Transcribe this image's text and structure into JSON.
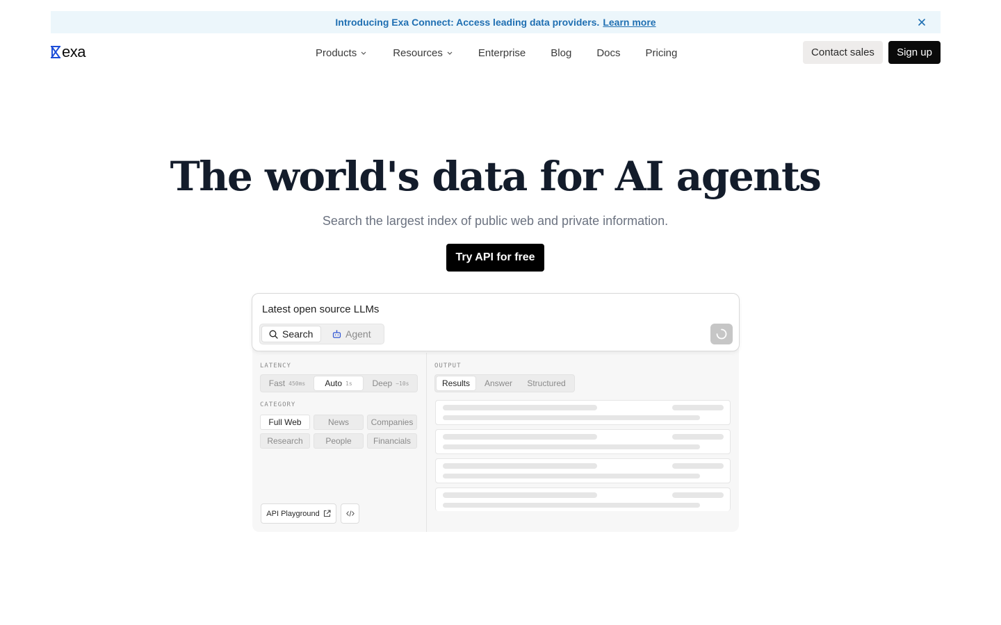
{
  "banner": {
    "message": "Introducing Exa Connect: Access leading data providers.",
    "link": "Learn more"
  },
  "brand": {
    "name": "exa",
    "accent": "#1d4ed8"
  },
  "nav": {
    "items": [
      {
        "label": "Products",
        "dropdown": true
      },
      {
        "label": "Resources",
        "dropdown": true
      },
      {
        "label": "Enterprise",
        "dropdown": false
      },
      {
        "label": "Blog",
        "dropdown": false
      },
      {
        "label": "Docs",
        "dropdown": false
      },
      {
        "label": "Pricing",
        "dropdown": false
      }
    ],
    "contact_sales": "Contact sales",
    "sign_up": "Sign up"
  },
  "hero": {
    "title": "The world's data for AI agents",
    "subtitle": "Search the largest index of public web and private information.",
    "cta": "Try API for free"
  },
  "demo": {
    "query": "Latest open source LLMs",
    "modes": [
      "Search",
      "Agent"
    ],
    "active_mode": "Search",
    "latency": {
      "label": "LATENCY",
      "options": [
        {
          "label": "Fast",
          "time": "450ms"
        },
        {
          "label": "Auto",
          "time": "1s"
        },
        {
          "label": "Deep",
          "time": "~10s"
        }
      ],
      "active": "Auto"
    },
    "category": {
      "label": "CATEGORY",
      "options": [
        "Full Web",
        "News",
        "Companies",
        "Research",
        "People",
        "Financials"
      ],
      "active": "Full Web"
    },
    "output": {
      "label": "OUTPUT",
      "tabs": [
        "Results",
        "Answer",
        "Structured"
      ],
      "active": "Results"
    },
    "api_playground": "API Playground"
  }
}
